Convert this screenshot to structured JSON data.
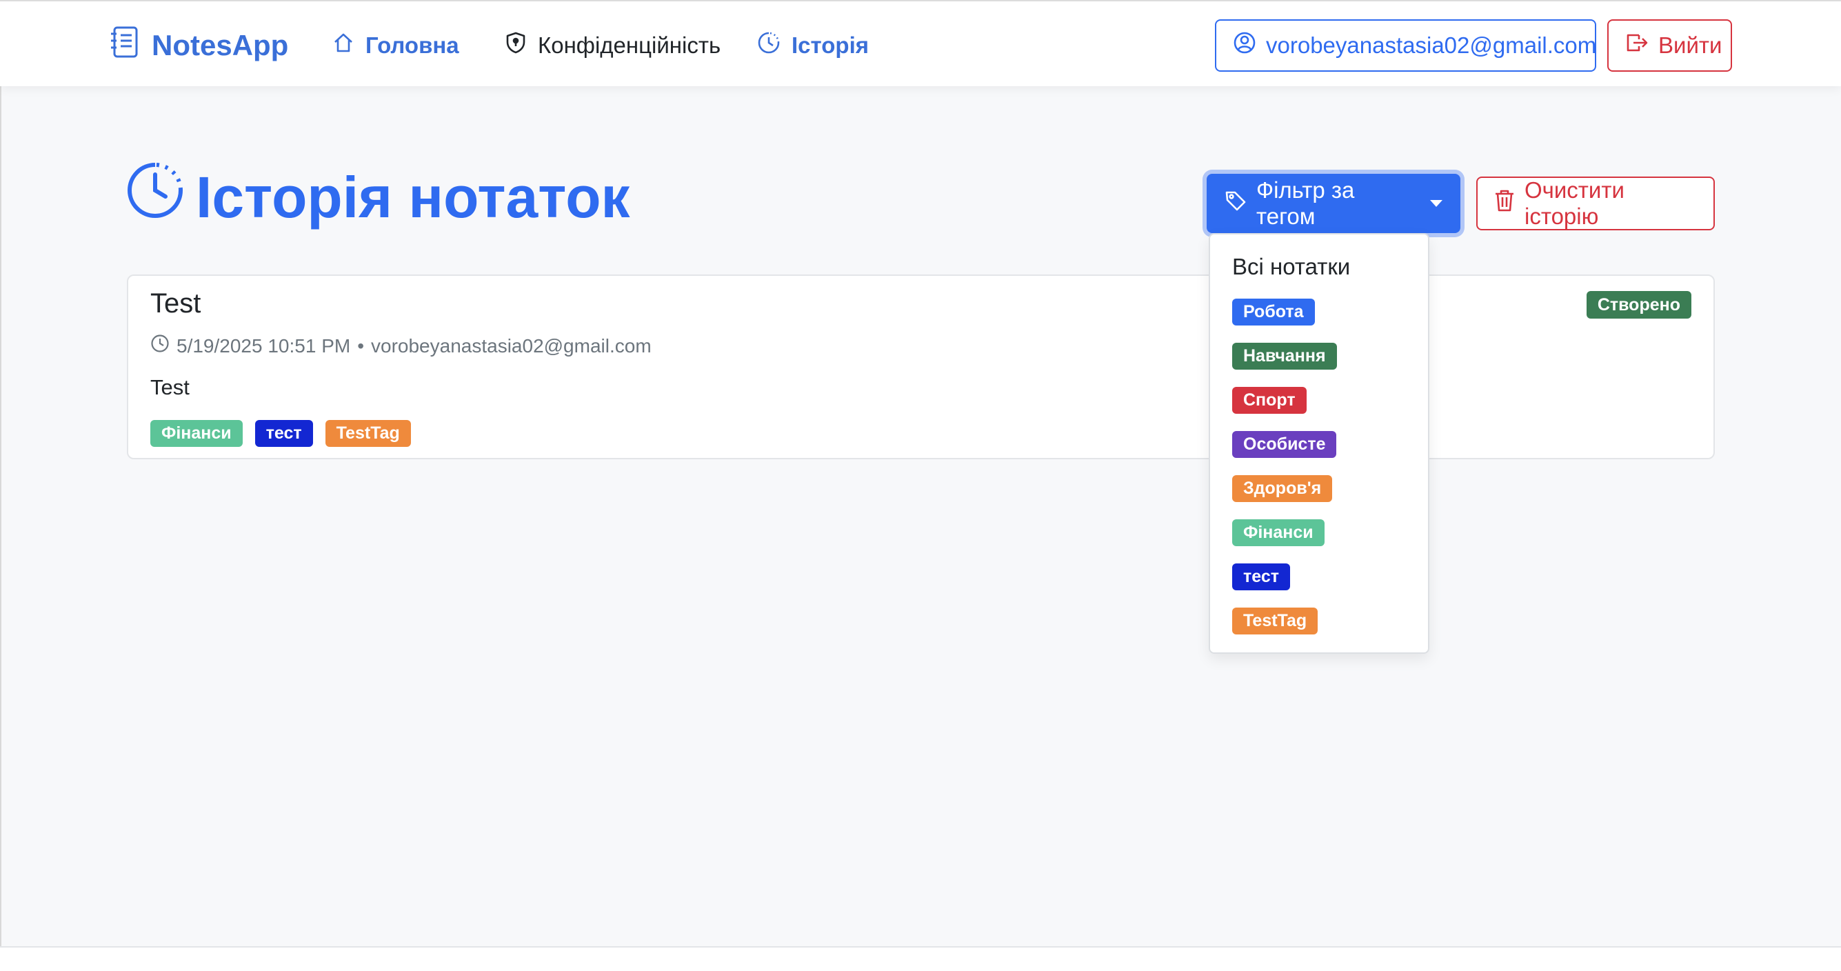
{
  "nav": {
    "brand": "NotesApp",
    "home": "Головна",
    "privacy": "Конфіденційність",
    "history": "Історія",
    "email": "vorobeyanastasia02@gmail.com",
    "logout": "Вийти"
  },
  "page": {
    "title": "Історія нотаток",
    "filter_button": "Фільтр за тегом",
    "clear_button": "Очистити історію"
  },
  "note": {
    "title": "Test",
    "datetime": "5/19/2025 10:51 PM",
    "separator": "•",
    "author": "vorobeyanastasia02@gmail.com",
    "body": "Test",
    "status": "Створено",
    "tags": [
      {
        "label": "Фінанси",
        "color": "#5cc498"
      },
      {
        "label": "тест",
        "color": "#1327d2"
      },
      {
        "label": "TestTag",
        "color": "#ef8a3c"
      }
    ]
  },
  "dropdown": {
    "all": "Всі нотатки",
    "tags": [
      {
        "label": "Робота",
        "color": "#2f6bf0"
      },
      {
        "label": "Навчання",
        "color": "#3b7d54"
      },
      {
        "label": "Спорт",
        "color": "#d6343f"
      },
      {
        "label": "Особисте",
        "color": "#6a3fbf"
      },
      {
        "label": "Здоров'я",
        "color": "#ef8a3c"
      },
      {
        "label": "Фінанси",
        "color": "#5cc498"
      },
      {
        "label": "тест",
        "color": "#1327d2"
      },
      {
        "label": "TestTag",
        "color": "#ef8a3c"
      }
    ]
  }
}
